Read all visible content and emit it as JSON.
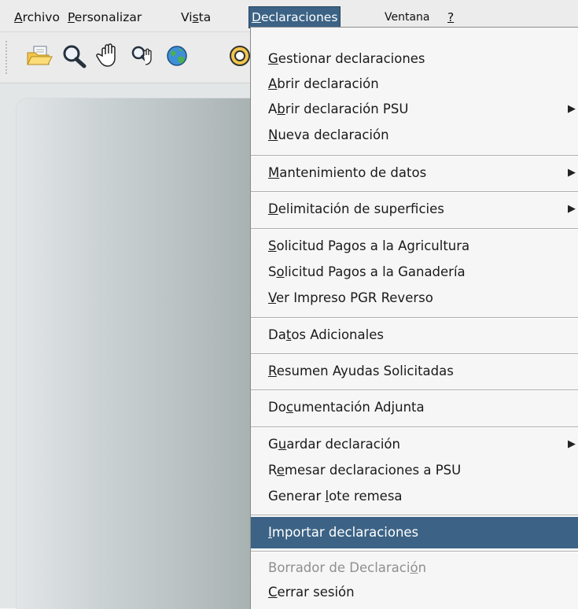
{
  "menubar": {
    "items": [
      {
        "pre": "",
        "ul": "A",
        "post": "rchivo"
      },
      {
        "pre": "",
        "ul": "P",
        "post": "ersonalizar"
      },
      {
        "pre": "Vi",
        "ul": "s",
        "post": "ta"
      },
      {
        "pre": "",
        "ul": "D",
        "post": "eclaraciones"
      },
      {
        "pre": "Ventana",
        "ul": "",
        "post": ""
      },
      {
        "pre": "",
        "ul": "?",
        "post": ""
      }
    ]
  },
  "toolbar": {
    "icons": [
      "open-folder-icon",
      "magnifier-icon",
      "hand-pan-icon",
      "zoom-window-icon",
      "globe-icon",
      "target-icon"
    ]
  },
  "dropdown": {
    "items": [
      {
        "pre": "",
        "ul": "G",
        "post": "estionar declaraciones"
      },
      {
        "pre": "",
        "ul": "A",
        "post": "brir declaración"
      },
      {
        "pre": "A",
        "ul": "b",
        "post": "rir declaración PSU",
        "arrow": "▶"
      },
      {
        "pre": "",
        "ul": "N",
        "post": "ueva declaración"
      },
      {
        "pre": "",
        "ul": "M",
        "post": "antenimiento de datos",
        "arrow": "▶"
      },
      {
        "pre": "",
        "ul": "D",
        "post": "elimitación de superficies",
        "arrow": "▶"
      },
      {
        "pre": "",
        "ul": "S",
        "post": "olicitud Pagos a la Agricultura"
      },
      {
        "pre": "S",
        "ul": "o",
        "post": "licitud Pagos a la Ganadería"
      },
      {
        "pre": "",
        "ul": "V",
        "post": "er Impreso PGR Reverso"
      },
      {
        "pre": "Da",
        "ul": "t",
        "post": "os Adicionales"
      },
      {
        "pre": "",
        "ul": "R",
        "post": "esumen Ayudas Solicitadas"
      },
      {
        "pre": "Do",
        "ul": "c",
        "post": "umentación Adjunta"
      },
      {
        "pre": "G",
        "ul": "u",
        "post": "ardar declaración",
        "arrow": "▶"
      },
      {
        "pre": "R",
        "ul": "e",
        "post": "mesar declaraciones a PSU"
      },
      {
        "pre": "Generar ",
        "ul": "l",
        "post": "ote remesa"
      },
      {
        "pre": "",
        "ul": "I",
        "post": "mportar declaraciones"
      },
      {
        "pre": "Borrador de Declaraci",
        "ul": "ó",
        "post": "n"
      },
      {
        "pre": "",
        "ul": "C",
        "post": "errar sesión"
      }
    ]
  }
}
